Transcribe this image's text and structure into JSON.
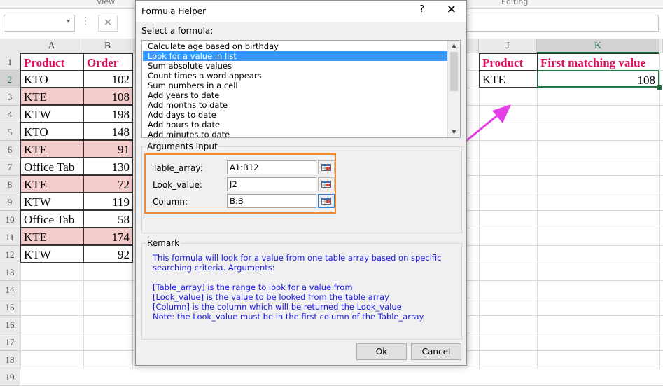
{
  "ribbon": {
    "group_view": "View",
    "group_editing": "Editing"
  },
  "formula_bar": {
    "name_box": "",
    "cancel_glyph": "✕",
    "dots": "⋮"
  },
  "columns": [
    "A",
    "B",
    "J",
    "K"
  ],
  "selected_column": "K",
  "rows": [
    "1",
    "2",
    "3",
    "4",
    "5",
    "6",
    "7",
    "8",
    "9",
    "10",
    "11",
    "12",
    "13",
    "14",
    "15",
    "16",
    "17",
    "18",
    "19"
  ],
  "selected_row": "2",
  "table": {
    "headers": [
      "Product",
      "Order"
    ],
    "rows": [
      {
        "product": "KTO",
        "order": "102",
        "highlight": false
      },
      {
        "product": "KTE",
        "order": "108",
        "highlight": true
      },
      {
        "product": "KTW",
        "order": "198",
        "highlight": false
      },
      {
        "product": "KTO",
        "order": "148",
        "highlight": false
      },
      {
        "product": "KTE",
        "order": "91",
        "highlight": true
      },
      {
        "product": "Office Tab",
        "order": "130",
        "highlight": false
      },
      {
        "product": "KTE",
        "order": "72",
        "highlight": true
      },
      {
        "product": "KTW",
        "order": "119",
        "highlight": false
      },
      {
        "product": "Office Tab",
        "order": "58",
        "highlight": false
      },
      {
        "product": "KTE",
        "order": "174",
        "highlight": true
      },
      {
        "product": "KTW",
        "order": "92",
        "highlight": false
      }
    ]
  },
  "lookup": {
    "header_product": "Product",
    "header_result": "First matching value",
    "product": "KTE",
    "result": "108"
  },
  "dialog": {
    "title": "Formula Helper",
    "help_glyph": "?",
    "close_glyph": "✕",
    "select_label": "Select a formula:",
    "formulas": [
      "Calculate age based on birthday",
      "Look for a value in list",
      "Sum absolute values",
      "Count times a word appears",
      "Sum numbers in a cell",
      "Add years to date",
      "Add months to date",
      "Add days to date",
      "Add hours to date",
      "Add minutes to date"
    ],
    "selected_formula": "Look for a value in list",
    "args_title": "Arguments Input",
    "args": [
      {
        "label": "Table_array:",
        "value": "A1:B12"
      },
      {
        "label": "Look_value:",
        "value": "J2"
      },
      {
        "label": "Column:",
        "value": "B:B"
      }
    ],
    "remark_title": "Remark",
    "remark_lines": [
      "This formula will look for a value from one table array based on specific",
      "searching criteria. Arguments:",
      "",
      "[Table_array] is the range to look for a value from",
      "[Look_value] is the value to be looked from the table array",
      "[Column] is the column which will be returned the Look_value",
      "Note: the Look_value must be in the first column of the Table_array"
    ],
    "ok_label": "Ok",
    "cancel_label": "Cancel"
  },
  "colors": {
    "header_text": "#e0105e",
    "highlight_fill": "#f4cccc",
    "arrow": "#e53ee8",
    "orange_box": "#f08a2e",
    "remark_text": "#1a1ae6",
    "selection_blue": "#3399ff",
    "excel_green": "#217346"
  }
}
